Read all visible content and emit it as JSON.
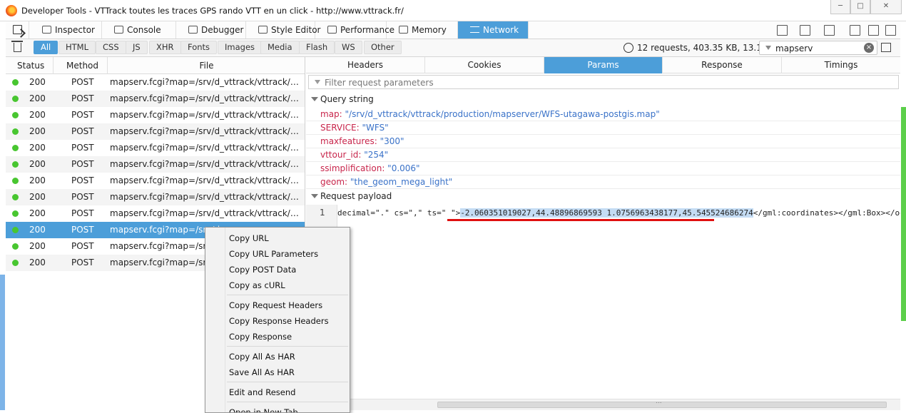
{
  "window": {
    "title": "Developer Tools - VTTrack toutes les traces GPS rando VTT en un click - http://www.vttrack.fr/",
    "controls": [
      "─",
      "□",
      "✕"
    ]
  },
  "toolbar": {
    "tabs": [
      {
        "label": "Inspector",
        "icon": "inspector-icon"
      },
      {
        "label": "Console",
        "icon": "console-icon"
      },
      {
        "label": "Debugger",
        "icon": "debugger-icon"
      },
      {
        "label": "Style Editor",
        "icon": "style-editor-icon"
      },
      {
        "label": "Performance",
        "icon": "performance-icon"
      },
      {
        "label": "Memory",
        "icon": "memory-icon"
      },
      {
        "label": "Network",
        "icon": "network-icon",
        "active": true
      }
    ]
  },
  "filterbar": {
    "types": [
      "All",
      "HTML",
      "CSS",
      "JS",
      "XHR",
      "Fonts",
      "Images",
      "Media",
      "Flash",
      "WS",
      "Other"
    ],
    "active_type": "All",
    "summary": "12 requests, 403.35 KB, 13.15 s",
    "search_value": "mapserv"
  },
  "list": {
    "columns": [
      "Status",
      "Method",
      "File"
    ],
    "rows": [
      {
        "status": "200",
        "method": "POST",
        "file": "mapserv.fcgi?map=/srv/d_vttrack/vttrack/productio..."
      },
      {
        "status": "200",
        "method": "POST",
        "file": "mapserv.fcgi?map=/srv/d_vttrack/vttrack/productio..."
      },
      {
        "status": "200",
        "method": "POST",
        "file": "mapserv.fcgi?map=/srv/d_vttrack/vttrack/productio..."
      },
      {
        "status": "200",
        "method": "POST",
        "file": "mapserv.fcgi?map=/srv/d_vttrack/vttrack/productio..."
      },
      {
        "status": "200",
        "method": "POST",
        "file": "mapserv.fcgi?map=/srv/d_vttrack/vttrack/productio..."
      },
      {
        "status": "200",
        "method": "POST",
        "file": "mapserv.fcgi?map=/srv/d_vttrack/vttrack/productio..."
      },
      {
        "status": "200",
        "method": "POST",
        "file": "mapserv.fcgi?map=/srv/d_vttrack/vttrack/productio..."
      },
      {
        "status": "200",
        "method": "POST",
        "file": "mapserv.fcgi?map=/srv/d_vttrack/vttrack/productio..."
      },
      {
        "status": "200",
        "method": "POST",
        "file": "mapserv.fcgi?map=/srv/d_vttrack/vttrack/productio..."
      },
      {
        "status": "200",
        "method": "POST",
        "file": "mapserv.fcgi?map=/srv/d_"
      },
      {
        "status": "200",
        "method": "POST",
        "file": "mapserv.fcgi?map=/srv/d_"
      },
      {
        "status": "200",
        "method": "POST",
        "file": "mapserv.fcgi?map=/srv/d_"
      }
    ],
    "selected_index": 9
  },
  "details": {
    "tabs": [
      "Headers",
      "Cookies",
      "Params",
      "Response",
      "Timings"
    ],
    "active_tab": "Params",
    "filter_placeholder": "Filter request parameters",
    "query_label": "Query string",
    "params": [
      {
        "key": "map",
        "value": "\"/srv/d_vttrack/vttrack/production/mapserver/WFS-utagawa-postgis.map\""
      },
      {
        "key": "SERVICE",
        "value": "\"WFS\""
      },
      {
        "key": "maxfeatures",
        "value": "\"300\""
      },
      {
        "key": "vttour_id",
        "value": "\"254\""
      },
      {
        "key": "ssimplification",
        "value": "\"0.006\""
      },
      {
        "key": "geom",
        "value": "\"the_geom_mega_light\""
      }
    ],
    "payload_label": "Request payload",
    "payload": {
      "line_number": "1",
      "prefix": "decimal=\".\" cs=\",\" ts=\" \">",
      "highlight": "-2.060351019027,44.48896869593 1.0756963438177,45.545524686274",
      "suffix": "</gml:coordinates></gml:Box></ogc:BBOX></ogc"
    },
    "scrollbar_grip": "..."
  },
  "context_menu": {
    "groups": [
      [
        "Copy URL",
        "Copy URL Parameters",
        "Copy POST Data",
        "Copy as cURL"
      ],
      [
        "Copy Request Headers",
        "Copy Response Headers",
        "Copy Response"
      ],
      [
        "Copy All As HAR",
        "Save All As HAR"
      ],
      [
        "Edit and Resend"
      ],
      [
        "Open in New Tab"
      ]
    ]
  }
}
